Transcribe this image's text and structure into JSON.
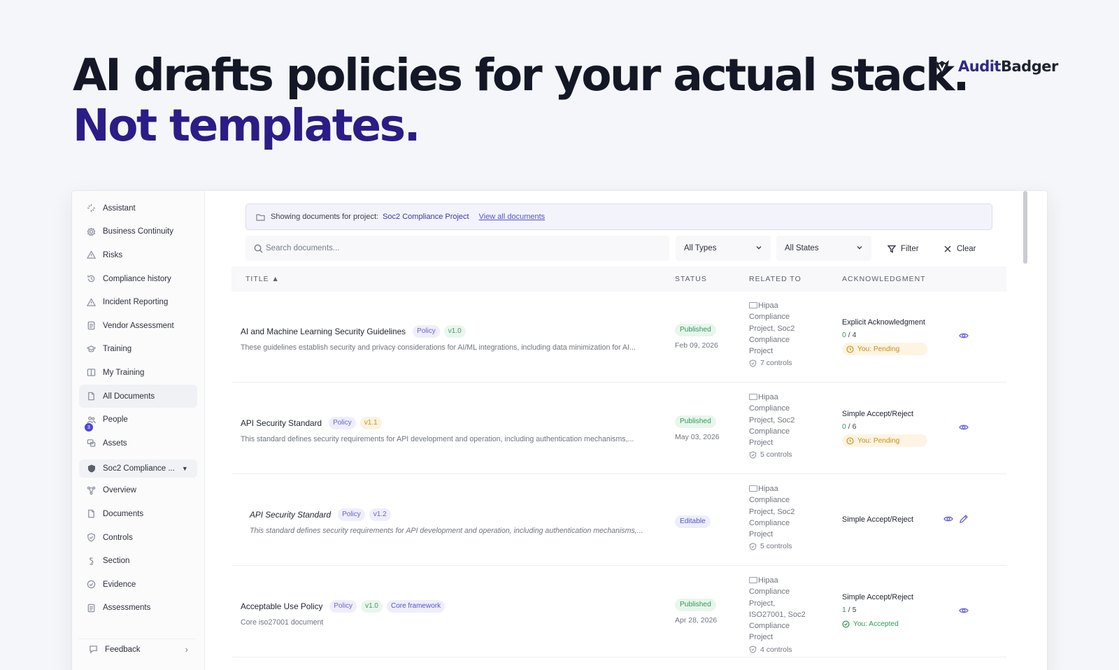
{
  "hero": {
    "line1": "AI drafts policies for your actual stack.",
    "line2": "Not templates."
  },
  "brand": {
    "name_part1": "Audit",
    "name_part2": "Badger",
    "logo_icon": "badger-icon"
  },
  "sidebar": {
    "items": [
      {
        "label": "Assistant",
        "icon": "sparkle-icon"
      },
      {
        "label": "Business Continuity",
        "icon": "gear-icon"
      },
      {
        "label": "Risks",
        "icon": "warning-icon"
      },
      {
        "label": "Compliance history",
        "icon": "history-icon"
      },
      {
        "label": "Incident Reporting",
        "icon": "warning-icon"
      },
      {
        "label": "Vendor Assessment",
        "icon": "clipboard-icon"
      },
      {
        "label": "Training",
        "icon": "graduation-icon"
      },
      {
        "label": "My Training",
        "icon": "book-icon"
      },
      {
        "label": "All Documents",
        "icon": "file-icon"
      },
      {
        "label": "People",
        "icon": "people-icon",
        "badge": "3"
      },
      {
        "label": "Assets",
        "icon": "assets-icon"
      }
    ],
    "project": {
      "label": "Soc2 Compliance ...",
      "icon": "shield-icon"
    },
    "project_items": [
      {
        "label": "Overview",
        "icon": "overview-icon"
      },
      {
        "label": "Documents",
        "icon": "file-icon"
      },
      {
        "label": "Controls",
        "icon": "shield-check-icon"
      },
      {
        "label": "Section",
        "icon": "section-icon"
      },
      {
        "label": "Evidence",
        "icon": "check-circle-icon"
      },
      {
        "label": "Assessments",
        "icon": "clipboard-icon"
      }
    ],
    "footer": {
      "label": "Feedback",
      "icon": "feedback-icon"
    }
  },
  "banner": {
    "prefix": "Showing documents for project:",
    "project": "Soc2 Compliance Project",
    "link": "View all documents"
  },
  "toolbar": {
    "search_placeholder": "Search documents...",
    "type_select": "All Types",
    "state_select": "All States",
    "filter_label": "Filter",
    "clear_label": "Clear"
  },
  "table": {
    "headers": {
      "title": "TITLE ▲",
      "status": "STATUS",
      "related": "RELATED TO",
      "ack": "ACKNOWLEDGMENT"
    },
    "rows": [
      {
        "title": "AI and Machine Learning Security Guidelines",
        "tags": [
          "Policy",
          "v1.0"
        ],
        "description": "These guidelines establish security and privacy considerations for AI/ML integrations, including data minimization for AI...",
        "status": "Published",
        "date": "Feb 09, 2026",
        "related_lines": [
          "Hipaa",
          "Compliance",
          "Project, Soc2",
          "Compliance",
          "Project"
        ],
        "controls": "7 controls",
        "ack_type": "Explicit Acknowledgment",
        "ack_done": "0",
        "ack_total": " / 4",
        "ack_state": "You: Pending"
      },
      {
        "title": "API Security Standard",
        "tags": [
          "Policy",
          "v1.1"
        ],
        "description": "This standard defines security requirements for API development and operation, including authentication mechanisms,...",
        "status": "Published",
        "date": "May 03, 2026",
        "related_lines": [
          "Hipaa",
          "Compliance",
          "Project, Soc2",
          "Compliance",
          "Project"
        ],
        "controls": "5 controls",
        "ack_type": "Simple Accept/Reject",
        "ack_done": "0",
        "ack_total": " / 6",
        "ack_state": "You: Pending"
      },
      {
        "title": "API Security Standard",
        "tags": [
          "Policy",
          "v1.2"
        ],
        "description": "This standard defines security requirements for API development and operation, including authentication mechanisms,...",
        "status": "Editable",
        "date": "",
        "related_lines": [
          "Hipaa",
          "Compliance",
          "Project, Soc2",
          "Compliance",
          "Project"
        ],
        "controls": "5 controls",
        "ack_type": "Simple Accept/Reject"
      },
      {
        "title": "Acceptable Use Policy",
        "tags": [
          "Policy",
          "v1.0",
          "Core framework"
        ],
        "description": "Core iso27001 document",
        "status": "Published",
        "date": "Apr 28, 2026",
        "related_lines": [
          "Hipaa",
          "Compliance",
          "Project,",
          "ISO27001, Soc2",
          "Compliance",
          "Project"
        ],
        "controls": "4 controls",
        "ack_type": "Simple Accept/Reject",
        "ack_done": "1",
        "ack_total": " / 5",
        "ack_state": "You: Accepted"
      }
    ]
  },
  "colors": {
    "accent": "#2a1d86",
    "brand_purple": "#5552d2",
    "published_green": "#2f9a5a",
    "pending_orange": "#c98f14"
  }
}
